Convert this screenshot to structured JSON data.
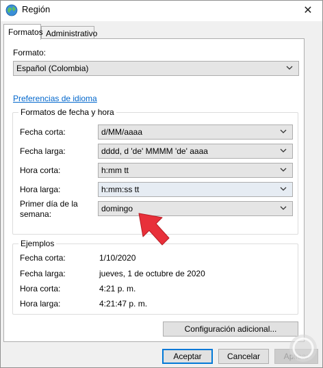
{
  "window": {
    "title": "Región",
    "close_glyph": "✕"
  },
  "tabs": [
    {
      "label": "Formatos",
      "active": true
    },
    {
      "label": "Administrativo",
      "active": false
    }
  ],
  "format": {
    "label": "Formato:",
    "value": "Español (Colombia)"
  },
  "language_link": "Preferencias de idioma",
  "date_time_group": {
    "title": "Formatos de fecha y hora",
    "rows": [
      {
        "label": "Fecha corta:",
        "value": "d/MM/aaaa"
      },
      {
        "label": "Fecha larga:",
        "value": "dddd, d 'de' MMMM 'de' aaaa"
      },
      {
        "label": "Hora corta:",
        "value": "h:mm tt"
      },
      {
        "label": "Hora larga:",
        "value": "h:mm:ss tt"
      },
      {
        "label_line1": "Primer día de la",
        "label_line2": "semana:",
        "value": "domingo"
      }
    ]
  },
  "examples_group": {
    "title": "Ejemplos",
    "rows": [
      {
        "label": "Fecha corta:",
        "value": "1/10/2020"
      },
      {
        "label": "Fecha larga:",
        "value": "jueves, 1 de octubre de 2020"
      },
      {
        "label": "Hora corta:",
        "value": "4:21 p. m."
      },
      {
        "label": "Hora larga:",
        "value": "4:21:47 p. m."
      }
    ]
  },
  "additional_settings_button": "Configuración adicional...",
  "footer": {
    "accept": "Aceptar",
    "cancel": "Cancelar",
    "apply": "Aplicar"
  },
  "colors": {
    "link": "#0066cc",
    "arrow": "#e8303a",
    "focus": "#0078d7"
  },
  "icons": [
    "globe-icon",
    "close-icon",
    "chevron-down-icon",
    "red-arrow-pointer"
  ]
}
